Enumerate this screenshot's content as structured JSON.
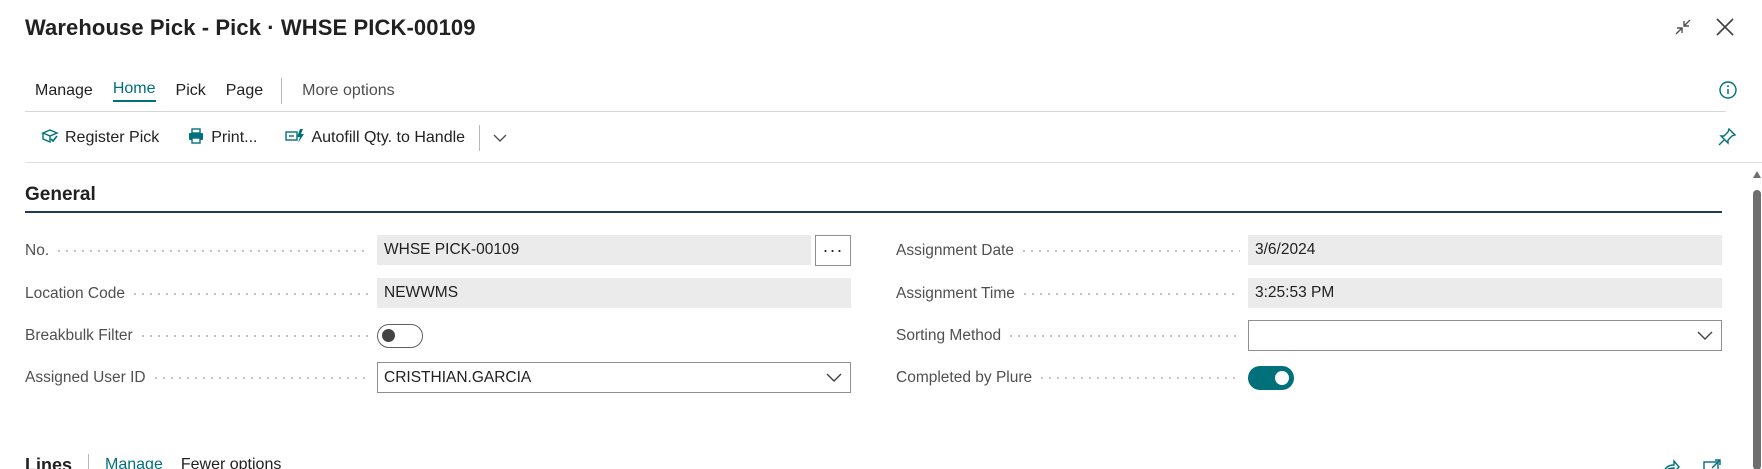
{
  "window": {
    "title": "Warehouse Pick - Pick · WHSE PICK-00109",
    "collapse_icon": "collapse-arrows-icon",
    "close_icon": "close-icon"
  },
  "action_tabs": [
    {
      "label": "Manage",
      "active": false
    },
    {
      "label": "Home",
      "active": true
    },
    {
      "label": "Pick",
      "active": false
    },
    {
      "label": "Page",
      "active": false
    }
  ],
  "more_options_label": "More options",
  "toolbar": {
    "register_pick": "Register Pick",
    "print": "Print...",
    "autofill": "Autofill Qty. to Handle"
  },
  "general": {
    "section_title": "General",
    "left_fields": {
      "no": {
        "label": "No.",
        "value": "WHSE PICK-00109"
      },
      "location_code": {
        "label": "Location Code",
        "value": "NEWWMS"
      },
      "breakbulk_filter": {
        "label": "Breakbulk Filter",
        "value": false
      },
      "assigned_user_id": {
        "label": "Assigned User ID",
        "value": "CRISTHIAN.GARCIA"
      }
    },
    "right_fields": {
      "assignment_date": {
        "label": "Assignment Date",
        "value": "3/6/2024"
      },
      "assignment_time": {
        "label": "Assignment Time",
        "value": "3:25:53 PM"
      },
      "sorting_method": {
        "label": "Sorting Method",
        "value": ""
      },
      "completed_by_plure": {
        "label": "Completed by Plure",
        "value": true
      }
    }
  },
  "lines": {
    "title": "Lines",
    "tabs": [
      "Manage",
      "Fewer options"
    ]
  },
  "colors": {
    "accent": "#00707a",
    "section_underline": "#1f3b5c",
    "readonly_field_bg": "#ebebeb"
  }
}
